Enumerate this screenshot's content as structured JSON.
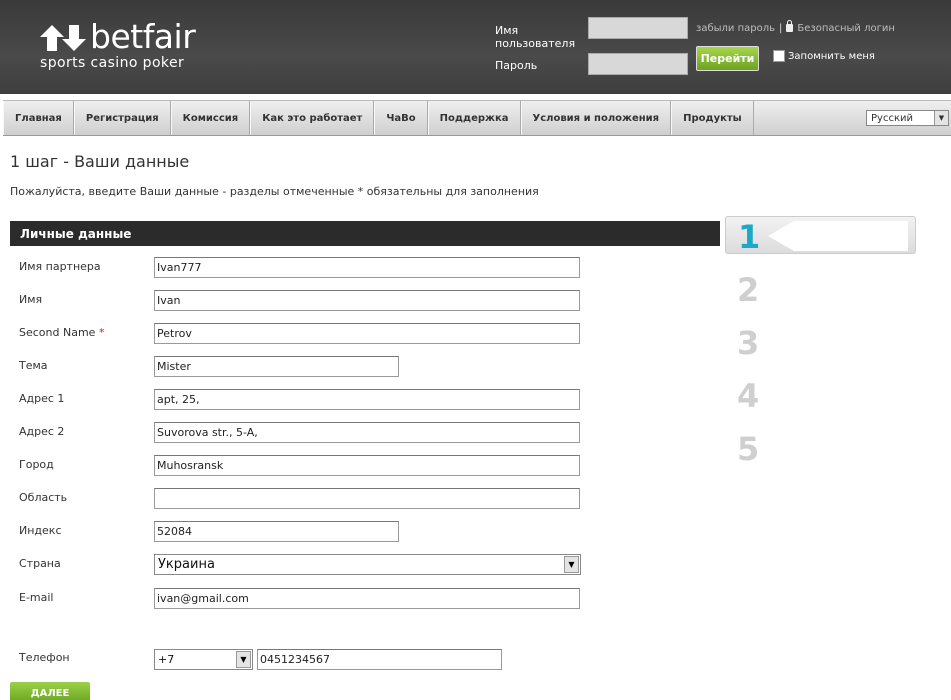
{
  "header": {
    "logo_word": "betfair",
    "logo_tagline": "sports casino poker",
    "username_label": "Имя пользователя",
    "password_label": "Пароль",
    "forgot_password": "забыли пароль",
    "secure_login": "Безопасный логин",
    "go_button": "Перейти",
    "remember_me": "Запомнить меня"
  },
  "nav": {
    "items": [
      "Главная",
      "Регистрация",
      "Комиссия",
      "Как это работает",
      "ЧаВо",
      "Поддержка",
      "Условия и положения",
      "Продукты"
    ],
    "language": "Русский"
  },
  "page": {
    "title": "1 шаг - Ваши данные",
    "intro": "Пожалуйста, введите Ваши данные - разделы отмеченные * обязательны для заполнения",
    "section_title": "Личные данные"
  },
  "form": {
    "partner_name_label": "Имя партнера",
    "partner_name_value": "Ivan777",
    "first_name_label": "Имя",
    "first_name_value": "Ivan",
    "second_name_label": "Second Name",
    "required_mark": "*",
    "second_name_value": "Petrov",
    "title_label": "Тема",
    "title_value": "Mister",
    "address1_label": "Адрес 1",
    "address1_value": "apt, 25,",
    "address2_label": "Адрес 2",
    "address2_value": "Suvorova str., 5-A,",
    "city_label": "Город",
    "city_value": "Muhosransk",
    "region_label": "Область",
    "region_value": "",
    "zip_label": "Индекс",
    "zip_value": "52084",
    "country_label": "Страна",
    "country_value": "Украина",
    "email_label": "E-mail",
    "email_value": "ivan@gmail.com",
    "phone_label": "Телефон",
    "phone_code_value": "+7",
    "phone_number_value": "0451234567",
    "next_button": "ДАЛЕЕ"
  },
  "steps": [
    "1",
    "2",
    "3",
    "4",
    "5"
  ],
  "colors": {
    "header_bg": "#404040",
    "accent_green": "#7ab32e",
    "step_active": "#1aa9c7",
    "step_inactive": "#cfcfcf"
  }
}
